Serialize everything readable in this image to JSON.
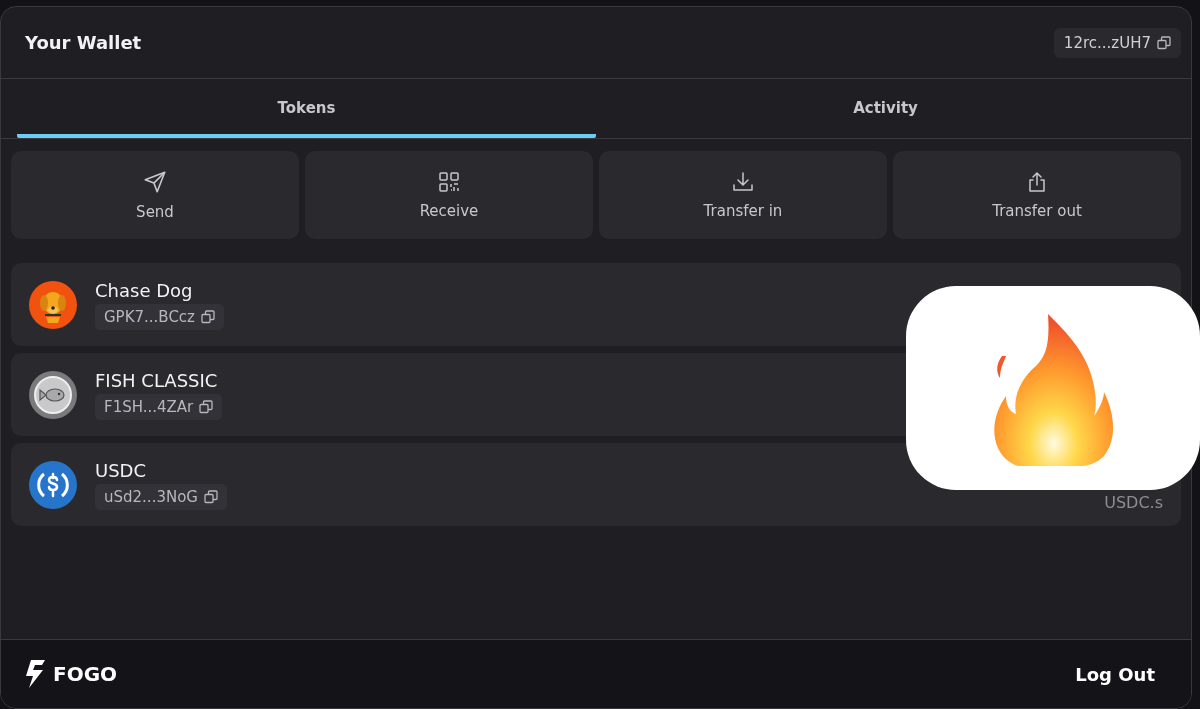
{
  "header": {
    "title": "Your Wallet",
    "address": "12rc...zUH7"
  },
  "tabs": [
    {
      "label": "Tokens",
      "selected": true
    },
    {
      "label": "Activity",
      "selected": false
    }
  ],
  "actions": [
    {
      "label": "Send",
      "kind": "send"
    },
    {
      "label": "Receive",
      "kind": "receive"
    },
    {
      "label": "Transfer in",
      "kind": "in"
    },
    {
      "label": "Transfer out",
      "kind": "out"
    }
  ],
  "tokens": [
    {
      "name": "Chase Dog",
      "address": "GPK7...BCcz",
      "kind": "dog"
    },
    {
      "name": "FISH CLASSIC",
      "address": "F1SH...4ZAr",
      "kind": "fish"
    },
    {
      "name": "USDC",
      "address": "uSd2...3NoG",
      "kind": "usdc",
      "symbol": "USDC.s"
    }
  ],
  "footer": {
    "brand": "FOGO",
    "logout": "Log Out"
  }
}
